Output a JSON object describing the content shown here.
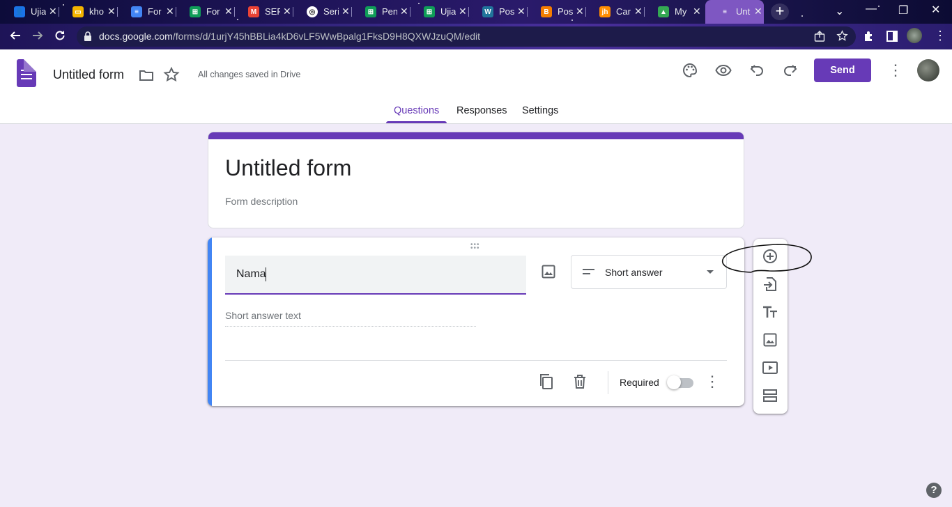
{
  "browser": {
    "tabs": [
      {
        "title": "Ujia",
        "favicon": "contacts-icon",
        "color": "#1a73e8"
      },
      {
        "title": "kho",
        "favicon": "slides-icon",
        "color": "#f4b400"
      },
      {
        "title": "For",
        "favicon": "docs-icon",
        "color": "#4285f4"
      },
      {
        "title": "For",
        "favicon": "sheets-icon",
        "color": "#0f9d58"
      },
      {
        "title": "SER",
        "favicon": "gmail-icon",
        "color": "#ea4335"
      },
      {
        "title": "Seri",
        "favicon": "site-icon",
        "color": "#ffffff"
      },
      {
        "title": "Pen",
        "favicon": "sheets-icon",
        "color": "#0f9d58"
      },
      {
        "title": "Ujia",
        "favicon": "sheets-icon",
        "color": "#0f9d58"
      },
      {
        "title": "Pos",
        "favicon": "wordpress-icon",
        "color": "#21759b"
      },
      {
        "title": "Pos",
        "favicon": "blogger-icon",
        "color": "#f57d00"
      },
      {
        "title": "Car",
        "favicon": "jh-icon",
        "color": "#ff8c00"
      },
      {
        "title": "My",
        "favicon": "drive-icon",
        "color": "#34a853"
      },
      {
        "title": "Unt",
        "favicon": "forms-icon",
        "color": "#7e57c2",
        "active": true
      }
    ],
    "url_host": "docs.google.com",
    "url_path": "/forms/d/1urjY45hBBLia4kD6vLF5WwBpalg1FksD9H8QXWJzuQM/edit"
  },
  "header": {
    "doc_title": "Untitled form",
    "save_status": "All changes saved in Drive",
    "send_label": "Send",
    "tabs": [
      "Questions",
      "Responses",
      "Settings"
    ],
    "active_tab": "Questions",
    "accent": "#673ab7"
  },
  "form": {
    "title": "Untitled form",
    "description_placeholder": "Form description"
  },
  "question": {
    "text": "Nama",
    "type": "Short answer",
    "answer_placeholder": "Short answer text",
    "required_label": "Required",
    "required": false
  },
  "help_label": "?"
}
